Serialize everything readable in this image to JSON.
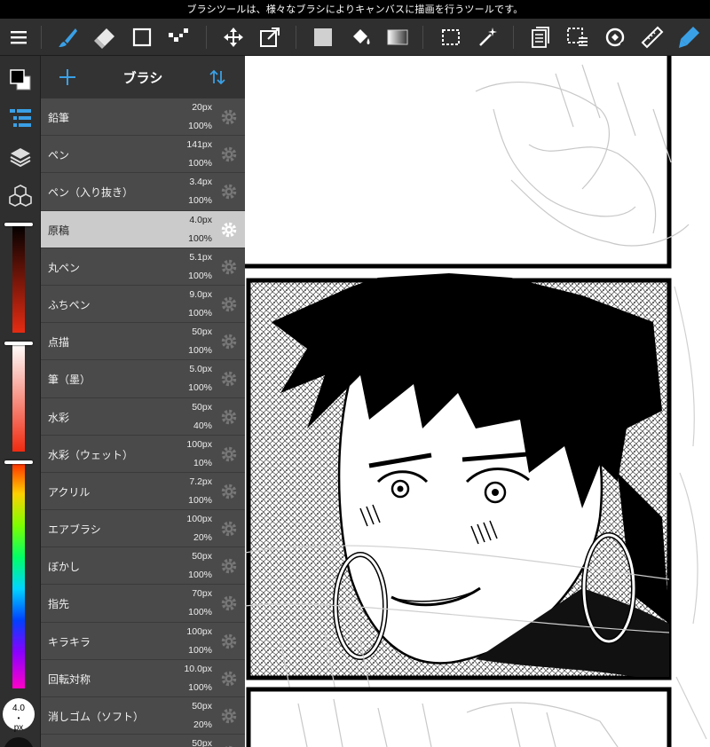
{
  "hint": "ブラシツールは、様々なブラシによりキャンバスに描画を行うツールです。",
  "toolbar": {
    "tools": [
      "menu-icon",
      "brush-icon",
      "eraser-icon",
      "rectangle-icon",
      "dot-icon",
      "move-icon",
      "transform-icon",
      "fill-rect-icon",
      "bucket-icon",
      "gradient-icon",
      "select-icon",
      "magic-wand-icon",
      "layers-copy-icon",
      "select-layer-icon",
      "rotate-icon",
      "ruler-icon",
      "pen-active-icon"
    ],
    "accent": "#3aa0e6"
  },
  "panel": {
    "title": "ブラシ",
    "brushes": [
      {
        "name": "鉛筆",
        "size": "20px",
        "opacity": "100%"
      },
      {
        "name": "ペン",
        "size": "141px",
        "opacity": "100%"
      },
      {
        "name": "ペン（入り抜き）",
        "size": "3.4px",
        "opacity": "100%"
      },
      {
        "name": "原稿",
        "size": "4.0px",
        "opacity": "100%",
        "selected": true
      },
      {
        "name": "丸ペン",
        "size": "5.1px",
        "opacity": "100%"
      },
      {
        "name": "ふちペン",
        "size": "9.0px",
        "opacity": "100%"
      },
      {
        "name": "点描",
        "size": "50px",
        "opacity": "100%"
      },
      {
        "name": "筆（墨）",
        "size": "5.0px",
        "opacity": "100%"
      },
      {
        "name": "水彩",
        "size": "50px",
        "opacity": "40%"
      },
      {
        "name": "水彩（ウェット）",
        "size": "100px",
        "opacity": "10%"
      },
      {
        "name": "アクリル",
        "size": "7.2px",
        "opacity": "100%"
      },
      {
        "name": "エアブラシ",
        "size": "100px",
        "opacity": "20%"
      },
      {
        "name": "ぼかし",
        "size": "50px",
        "opacity": "100%"
      },
      {
        "name": "指先",
        "size": "70px",
        "opacity": "100%"
      },
      {
        "name": "キラキラ",
        "size": "100px",
        "opacity": "100%"
      },
      {
        "name": "回転対称",
        "size": "10.0px",
        "opacity": "100%"
      },
      {
        "name": "消しゴム（ソフト）",
        "size": "50px",
        "opacity": "20%"
      },
      {
        "name": "",
        "size": "50px",
        "opacity": ""
      }
    ]
  },
  "rail": {
    "brush_size_value": "4.0",
    "brush_size_unit": "px"
  }
}
